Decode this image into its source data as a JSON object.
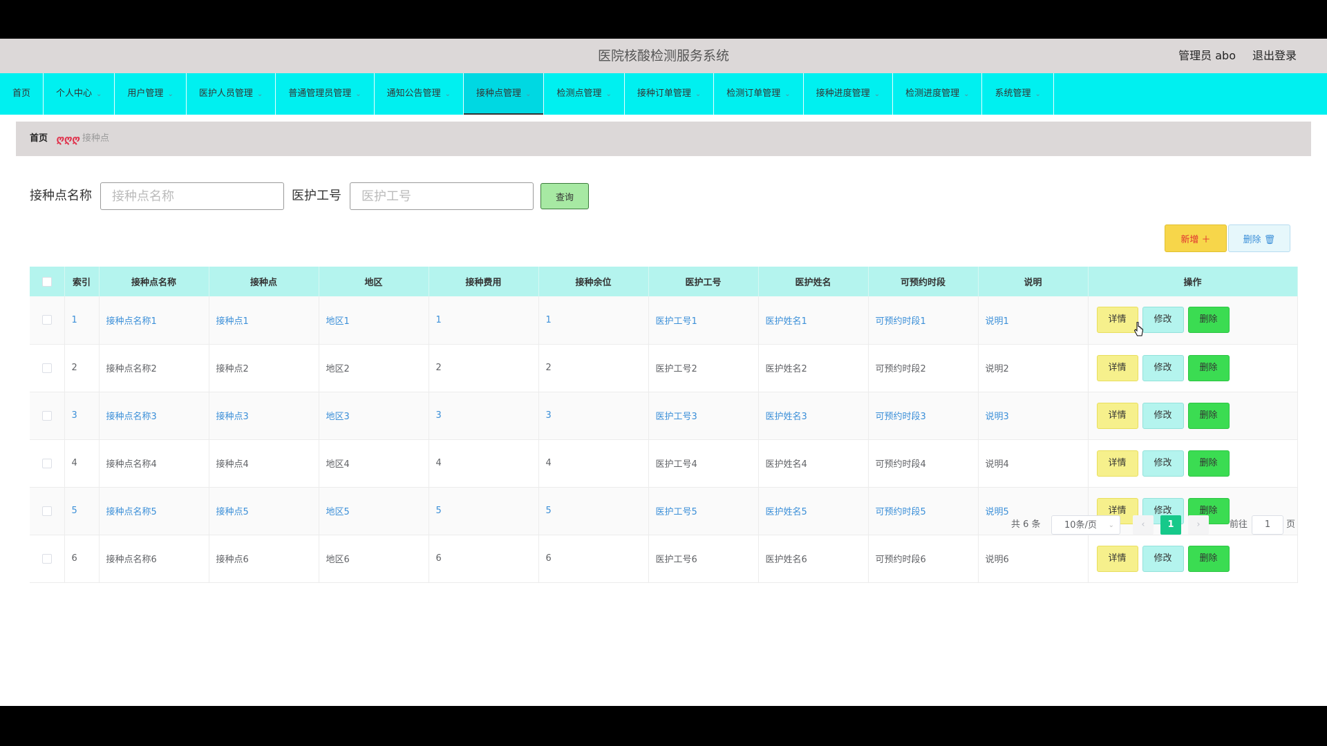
{
  "header": {
    "title": "医院核酸检测服务系统",
    "user": "管理员 abo",
    "logout": "退出登录"
  },
  "nav": [
    {
      "label": "首页",
      "dropdown": false
    },
    {
      "label": "个人中心",
      "dropdown": true
    },
    {
      "label": "用户管理",
      "dropdown": true
    },
    {
      "label": "医护人员管理",
      "dropdown": true
    },
    {
      "label": "普通管理员管理",
      "dropdown": true
    },
    {
      "label": "通知公告管理",
      "dropdown": true
    },
    {
      "label": "接种点管理",
      "dropdown": true,
      "active": true
    },
    {
      "label": "检测点管理",
      "dropdown": true
    },
    {
      "label": "接种订单管理",
      "dropdown": true
    },
    {
      "label": "检测订单管理",
      "dropdown": true
    },
    {
      "label": "接种进度管理",
      "dropdown": true
    },
    {
      "label": "检测进度管理",
      "dropdown": true
    },
    {
      "label": "系统管理",
      "dropdown": true
    }
  ],
  "breadcrumb": {
    "home": "首页",
    "separator": "ღღღ",
    "current": "接种点"
  },
  "search": {
    "name_label": "接种点名称",
    "name_placeholder": "接种点名称",
    "staff_label": "医护工号",
    "staff_placeholder": "医护工号",
    "query_button": "查询"
  },
  "actions": {
    "add": "新增 ＋",
    "delete": "删除 🗑"
  },
  "table": {
    "columns": [
      "索引",
      "接种点名称",
      "接种点",
      "地区",
      "接种费用",
      "接种余位",
      "医护工号",
      "医护姓名",
      "可预约时段",
      "说明",
      "操作"
    ],
    "rows": [
      [
        "1",
        "接种点名称1",
        "接种点1",
        "地区1",
        "1",
        "1",
        "医护工号1",
        "医护姓名1",
        "可预约时段1",
        "说明1"
      ],
      [
        "2",
        "接种点名称2",
        "接种点2",
        "地区2",
        "2",
        "2",
        "医护工号2",
        "医护姓名2",
        "可预约时段2",
        "说明2"
      ],
      [
        "3",
        "接种点名称3",
        "接种点3",
        "地区3",
        "3",
        "3",
        "医护工号3",
        "医护姓名3",
        "可预约时段3",
        "说明3"
      ],
      [
        "4",
        "接种点名称4",
        "接种点4",
        "地区4",
        "4",
        "4",
        "医护工号4",
        "医护姓名4",
        "可预约时段4",
        "说明4"
      ],
      [
        "5",
        "接种点名称5",
        "接种点5",
        "地区5",
        "5",
        "5",
        "医护工号5",
        "医护姓名5",
        "可预约时段5",
        "说明5"
      ],
      [
        "6",
        "接种点名称6",
        "接种点6",
        "地区6",
        "6",
        "6",
        "医护工号6",
        "医护姓名6",
        "可预约时段6",
        "说明6"
      ]
    ],
    "ops": {
      "detail": "详情",
      "edit": "修改",
      "delete": "删除"
    }
  },
  "pager": {
    "total": "共 6 条",
    "page_size": "10条/页",
    "prev": "‹",
    "current_page": "1",
    "next": "›",
    "goto_label": "前往",
    "goto_value": "1",
    "unit": "页"
  },
  "colors": {
    "nav_bg": "#00f0f0",
    "header_bg": "#dcd8d8",
    "table_header_bg": "#b4f4ee",
    "link": "#3b8fd8",
    "detail_btn": "#f6f08c",
    "edit_btn": "#b4f4ee",
    "delete_btn": "#3bdc52",
    "page_active": "#16c98a"
  }
}
